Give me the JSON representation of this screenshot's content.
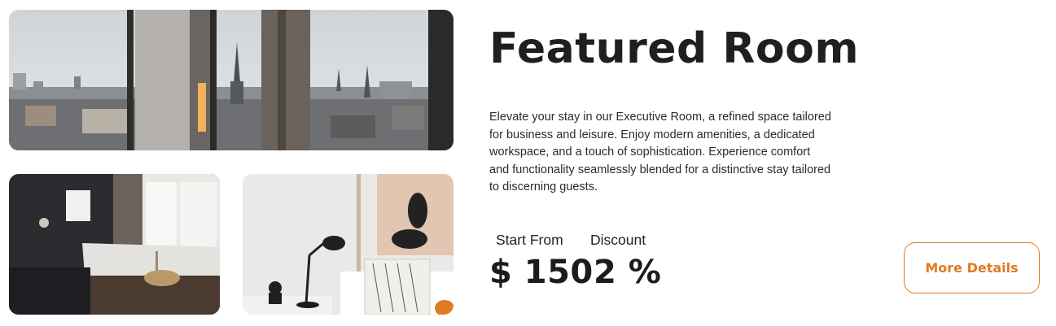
{
  "featured": {
    "title": "Featured Room",
    "description": "Elevate your stay in our Executive Room, a refined space tailored for business and leisure. Enjoy modern amenities, a dedicated workspace, and a touch of sophistication. Experience comfort and functionality seamlessly blended for a distinctive stay tailored to discerning guests.",
    "start_from_label": "Start From",
    "discount_label": "Discount",
    "price": "$ 150",
    "discount": "2 %",
    "button_label": "More Details"
  },
  "colors": {
    "accent": "#e07b22",
    "text": "#222222"
  }
}
